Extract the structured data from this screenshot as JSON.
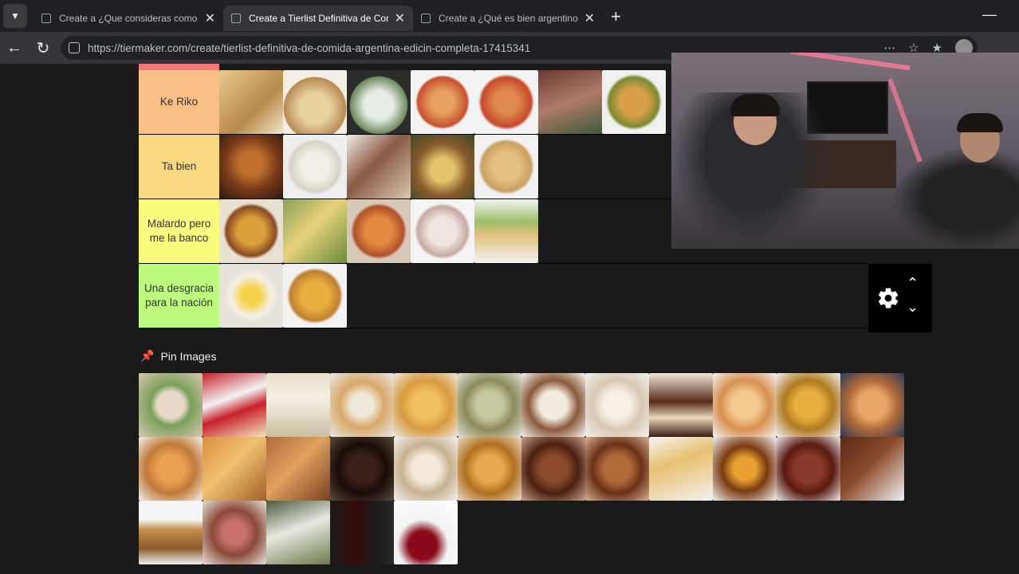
{
  "browser": {
    "tabs": [
      {
        "title": "Create a ¿Que consideras como m",
        "active": false
      },
      {
        "title": "Create a Tierlist Definitiva de Com",
        "active": true
      },
      {
        "title": "Create a ¿Qué es bien argentino y",
        "active": false
      }
    ],
    "url": "https://tiermaker.com/create/tierlist-definitiva-de-comida-argentina-edicin-completa-17415341"
  },
  "tiers": [
    {
      "label": "Ke Riko",
      "color": "#f9bf84",
      "items": 7
    },
    {
      "label": "Ta bien",
      "color": "#fbd980",
      "items": 5
    },
    {
      "label": "Malardo pero me la banco",
      "color": "#fbfb7f",
      "items": 5
    },
    {
      "label": "Una desgracia para la nación",
      "color": "#bdfb7f",
      "items": 2
    }
  ],
  "pin": {
    "title": "Pin Images",
    "rows": [
      12,
      12,
      5
    ]
  }
}
